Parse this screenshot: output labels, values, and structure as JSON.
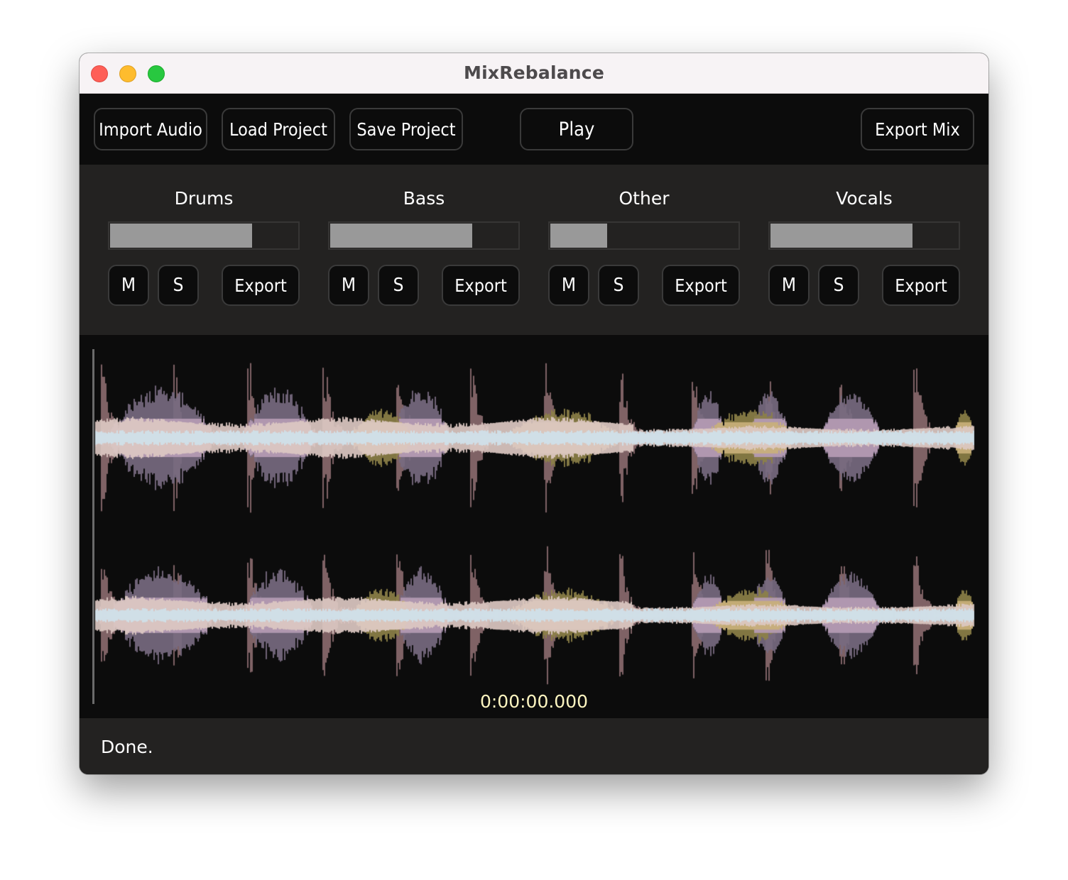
{
  "window": {
    "title": "MixRebalance",
    "controls": [
      "close",
      "minimize",
      "maximize"
    ]
  },
  "toolbar": {
    "import_audio_label": "Import Audio",
    "load_project_label": "Load Project",
    "save_project_label": "Save Project",
    "play_label": "Play",
    "export_mix_label": "Export Mix"
  },
  "stems": [
    {
      "name": "Drums",
      "gain": 0.75,
      "mute_label": "M",
      "solo_label": "S",
      "export_label": "Export",
      "color": "#8a6a6e"
    },
    {
      "name": "Bass",
      "gain": 0.75,
      "mute_label": "M",
      "solo_label": "S",
      "export_label": "Export",
      "color": "#bfe6e0"
    },
    {
      "name": "Other",
      "gain": 0.3,
      "mute_label": "M",
      "solo_label": "S",
      "export_label": "Export",
      "color": "#8c8048"
    },
    {
      "name": "Vocals",
      "gain": 0.75,
      "mute_label": "M",
      "solo_label": "S",
      "export_label": "Export",
      "color": "#78697e"
    }
  ],
  "waveform": {
    "channels": [
      "left",
      "right"
    ],
    "layer_colors": {
      "drums": "#8a6a6e",
      "vocals": "#776a80",
      "vocals_mid": "#b59bb4",
      "other": "#8c8048",
      "other_mid": "#c9b07a",
      "blend": "#dcc8c2",
      "bass": "#cfe1ea"
    },
    "background": "#0c0c0c"
  },
  "transport": {
    "timecode": "0:00:00.000",
    "timecode_color": "#fdf5c0"
  },
  "status": {
    "message": "Done."
  }
}
